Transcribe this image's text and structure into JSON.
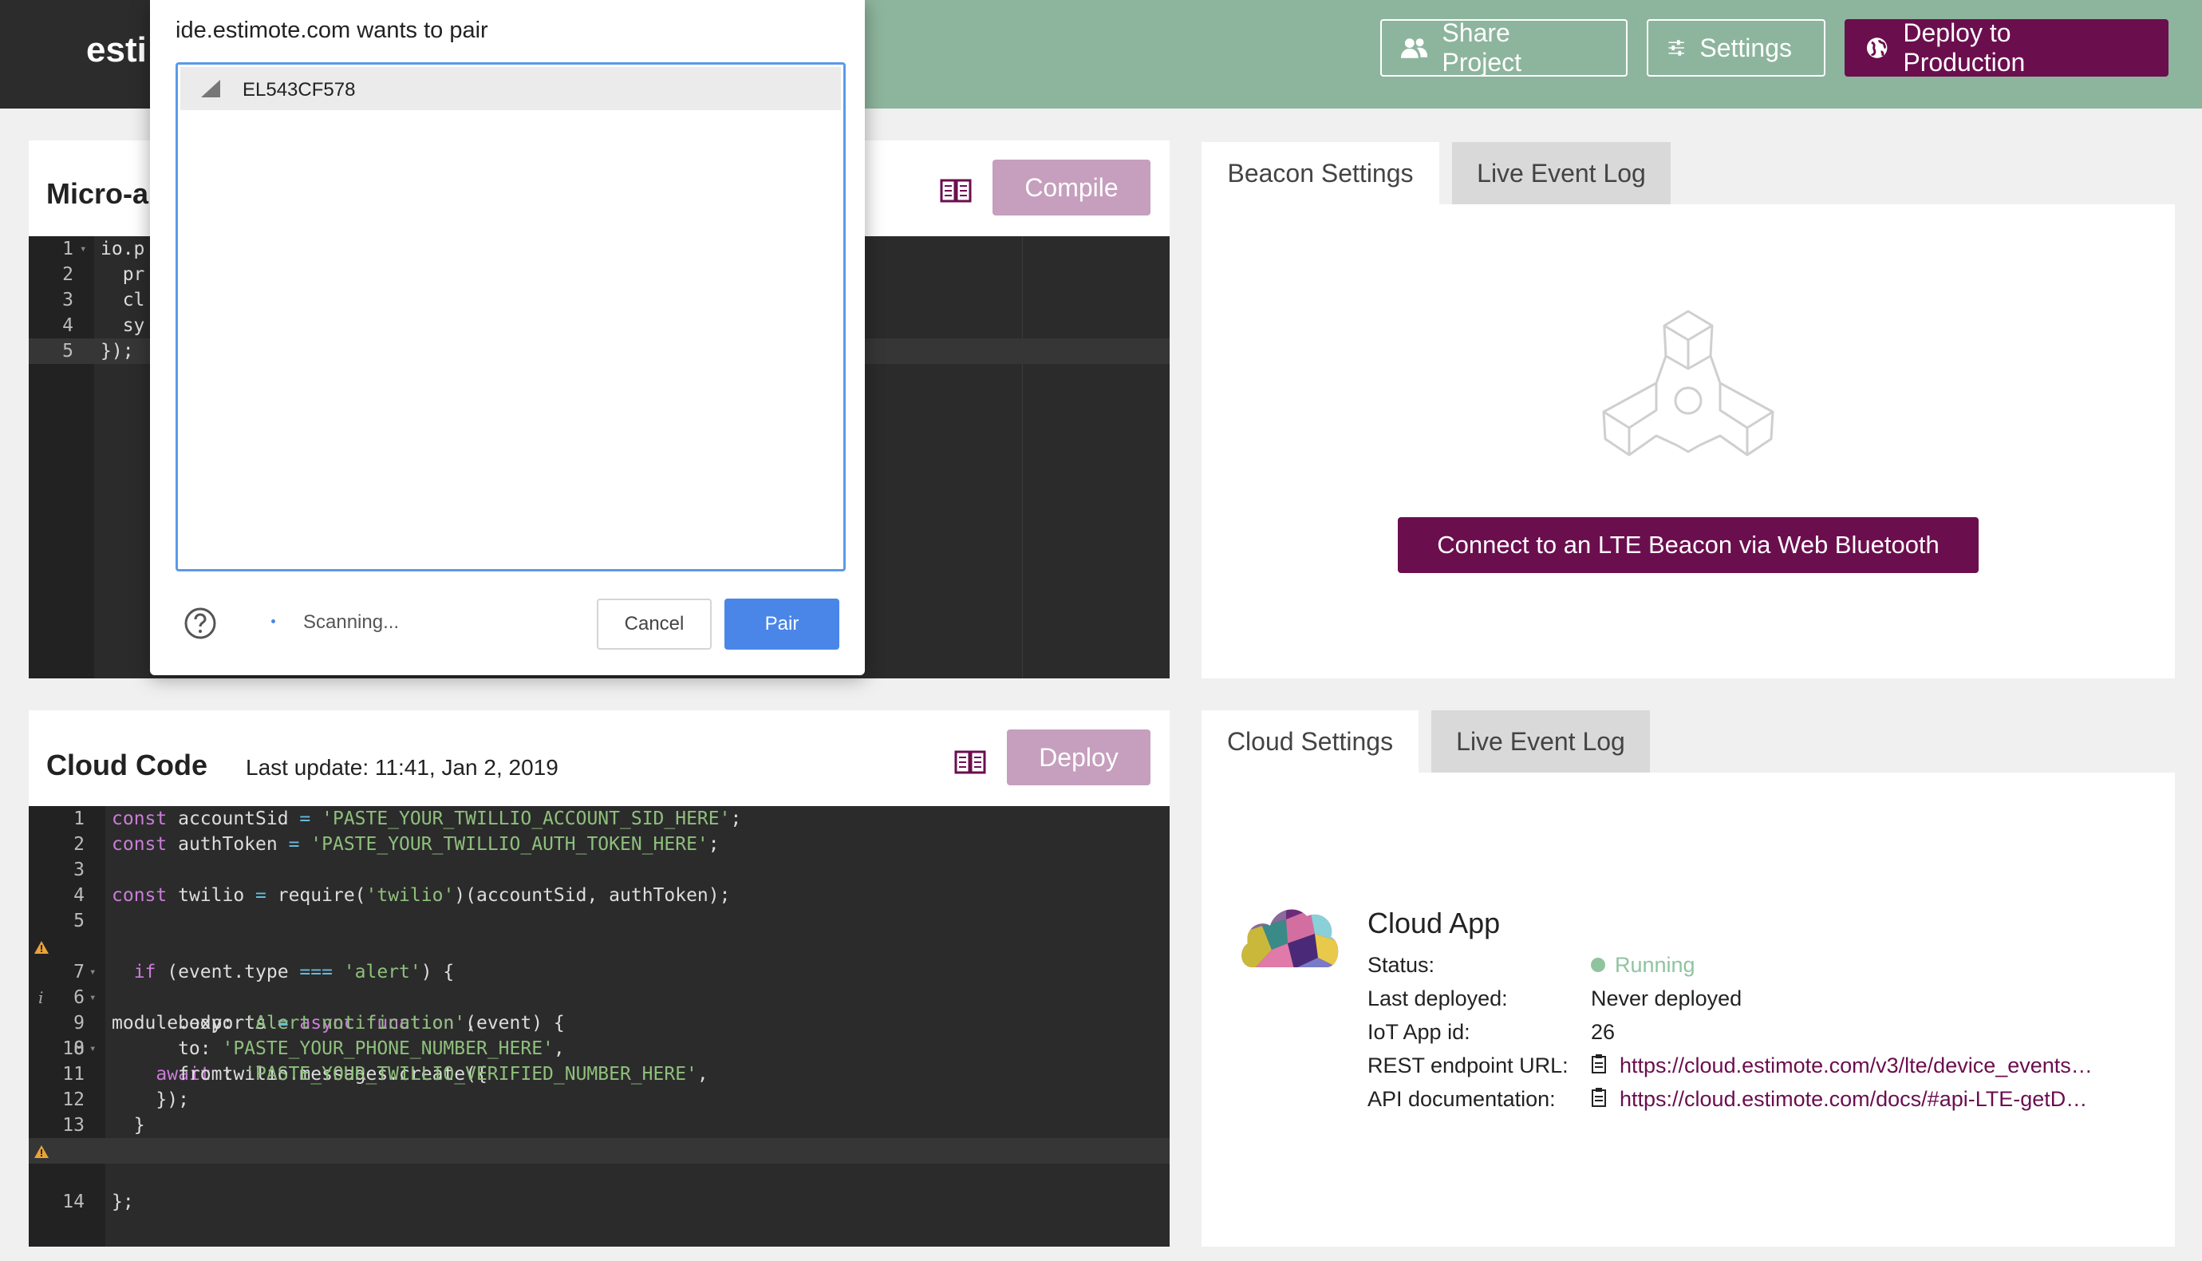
{
  "header": {
    "logo_text": "esti",
    "share_label": "Share Project",
    "settings_label": "Settings",
    "deploy_prod_label": "Deploy to Production",
    "accent": "#8db59d",
    "brand": "#6b0e4e"
  },
  "micro_app": {
    "title": "Micro-a",
    "compile_label": "Compile",
    "lines": [
      {
        "n": "1",
        "text": "io.p"
      },
      {
        "n": "2",
        "text": "  pr"
      },
      {
        "n": "3",
        "text": "  cl"
      },
      {
        "n": "4",
        "text": "  sy"
      },
      {
        "n": "5",
        "text": "});"
      }
    ]
  },
  "cloud_code": {
    "title": "Cloud Code",
    "last_update": "Last update: 11:41, Jan 2, 2019",
    "deploy_label": "Deploy",
    "lines": {
      "l1": {
        "kw": "const",
        "ident": " accountSid ",
        "op": "=",
        "str": " 'PASTE_YOUR_TWILLIO_ACCOUNT_SID_HERE'",
        "tail": ";"
      },
      "l2": {
        "kw": "const",
        "ident": " authToken ",
        "op": "=",
        "str": " 'PASTE_YOUR_TWILLIO_AUTH_TOKEN_HERE'",
        "tail": ";"
      },
      "l4": {
        "kw": "const",
        "ident": " twilio ",
        "op": "=",
        "a": " require(",
        "str": "'twilio'",
        "b": ")(accountSid, authToken);"
      },
      "l6": {
        "a": "module.exports ",
        "op": "=",
        "kw": " async function",
        "b": " (event) {"
      },
      "l7": {
        "kw": "  if",
        "a": " (event.type ",
        "op": "===",
        "str": " 'alert'",
        "b": ") {"
      },
      "l8": {
        "kw": "    await",
        "a": " twilio.messages.create({"
      },
      "l9": {
        "a": "      body: ",
        "str": "'Alert notification'",
        "b": ","
      },
      "l10": {
        "a": "      to: ",
        "str": "'PASTE_YOUR_PHONE_NUMBER_HERE'",
        "b": ","
      },
      "l11": {
        "a": "      from: ",
        "str": "'PASTE_YOUR_TWILLIO_VERIFIED_NUMBER_HERE'",
        "b": ","
      },
      "l12": {
        "a": "    });"
      },
      "l13": {
        "a": "  }"
      },
      "l14": {
        "a": "};"
      }
    }
  },
  "beacon": {
    "tab_settings": "Beacon Settings",
    "tab_log": "Live Event Log",
    "connect_label": "Connect to an LTE Beacon via Web Bluetooth"
  },
  "cloud": {
    "tab_settings": "Cloud Settings",
    "tab_log": "Live Event Log",
    "app_title": "Cloud App",
    "status_label": "Status:",
    "status_value": "Running",
    "last_deployed_label": "Last deployed:",
    "last_deployed_value": "Never deployed",
    "app_id_label": "IoT App id:",
    "app_id_value": "26",
    "rest_label": "REST endpoint URL:",
    "rest_value": "https://cloud.estimote.com/v3/lte/device_events…",
    "api_label": "API documentation:",
    "api_value": "https://cloud.estimote.com/docs/#api-LTE-getD…"
  },
  "dialog": {
    "title": "ide.estimote.com wants to pair",
    "device": "EL543CF578",
    "scanning": "Scanning...",
    "cancel_label": "Cancel",
    "pair_label": "Pair"
  }
}
